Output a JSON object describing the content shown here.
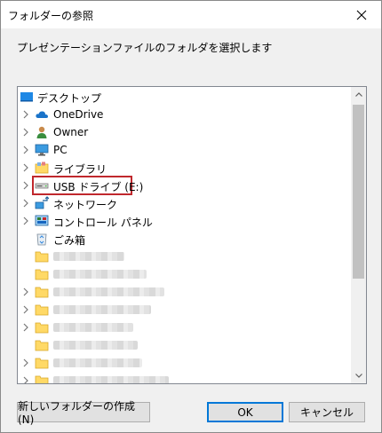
{
  "window": {
    "title": "フォルダーの参照"
  },
  "instruction": "プレゼンテーションファイルのフォルダを選択します",
  "tree": {
    "root": {
      "label": "デスクトップ",
      "icon": "desktop-icon"
    },
    "items": [
      {
        "label": "OneDrive",
        "icon": "onedrive-cloud-icon",
        "expandable": true
      },
      {
        "label": "Owner",
        "icon": "user-folder-icon",
        "expandable": true
      },
      {
        "label": "PC",
        "icon": "pc-monitor-icon",
        "expandable": true
      },
      {
        "label": "ライブラリ",
        "icon": "library-icon",
        "expandable": true
      },
      {
        "label": "USB ドライブ (E:)",
        "icon": "usb-drive-icon",
        "expandable": true,
        "selected": true
      },
      {
        "label": "ネットワーク",
        "icon": "network-icon",
        "expandable": true
      },
      {
        "label": "コントロール パネル",
        "icon": "control-panel-icon",
        "expandable": true
      },
      {
        "label": "ごみ箱",
        "icon": "recycle-bin-icon",
        "expandable": false
      }
    ],
    "obscured_folder_count": 8
  },
  "buttons": {
    "new_folder": "新しいフォルダーの作成(N)",
    "ok": "OK",
    "cancel": "キャンセル"
  },
  "colors": {
    "selection_highlight": "#c0282d",
    "default_button_border": "#0078d7",
    "folder": "#ffd966"
  }
}
